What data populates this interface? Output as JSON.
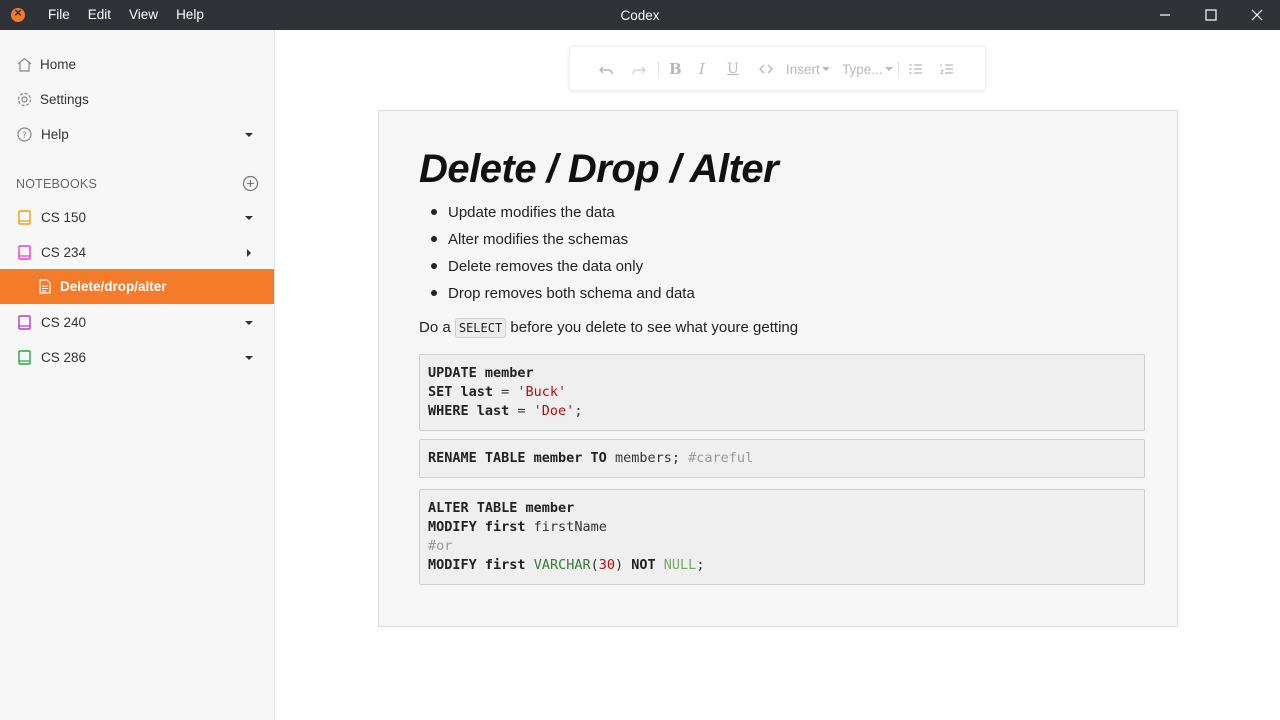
{
  "titlebar": {
    "title": "Codex",
    "menu": [
      "File",
      "Edit",
      "View",
      "Help"
    ]
  },
  "sidebar": {
    "nav": [
      {
        "label": "Home",
        "icon": "home-icon"
      },
      {
        "label": "Settings",
        "icon": "gear-icon"
      },
      {
        "label": "Help",
        "icon": "help-circle-icon"
      }
    ],
    "notebooks_header": "NOTEBOOKS",
    "notebooks": [
      {
        "label": "CS 150",
        "color": "#f39c12",
        "expanded": true
      },
      {
        "label": "CS 234",
        "color": "#e83ecf",
        "expanded": false
      },
      {
        "label": "Delete/drop/alter",
        "active": true
      },
      {
        "label": "CS 240",
        "color": "#b23ad1",
        "expanded": true
      },
      {
        "label": "CS 286",
        "color": "#27a844",
        "expanded": true
      }
    ]
  },
  "toolbar": {
    "insert_label": "Insert",
    "type_label": "Type..."
  },
  "document": {
    "title": "Delete / Drop / Alter",
    "bullets": [
      "Update modifies the data",
      "Alter modifies the schemas",
      "Delete removes the data only",
      "Drop removes both schema and data"
    ],
    "para_before": "Do a",
    "para_code": "SELECT",
    "para_after": "before you delete to see what youre getting",
    "code_blocks": [
      [
        [
          {
            "t": "UPDATE member",
            "c": "kw"
          }
        ],
        [
          {
            "t": "SET last",
            "c": "kw"
          },
          {
            "t": " = ",
            "c": ""
          },
          {
            "t": "'Buck'",
            "c": "str"
          }
        ],
        [
          {
            "t": "WHERE last",
            "c": "kw"
          },
          {
            "t": " = ",
            "c": ""
          },
          {
            "t": "'Doe'",
            "c": "str"
          },
          {
            "t": ";",
            "c": ""
          }
        ]
      ],
      [
        [
          {
            "t": "RENAME TABLE member TO",
            "c": "kw"
          },
          {
            "t": " members; ",
            "c": ""
          },
          {
            "t": "#careful",
            "c": "cm"
          }
        ]
      ],
      [
        [
          {
            "t": "ALTER TABLE member",
            "c": "kw"
          }
        ],
        [
          {
            "t": "MODIFY first",
            "c": "kw"
          },
          {
            "t": " firstName",
            "c": ""
          }
        ],
        [
          {
            "t": "#or",
            "c": "cm"
          }
        ],
        [
          {
            "t": "MODIFY first",
            "c": "kw"
          },
          {
            "t": " ",
            "c": ""
          },
          {
            "t": "VARCHAR",
            "c": "ty"
          },
          {
            "t": "(",
            "c": ""
          },
          {
            "t": "30",
            "c": "num"
          },
          {
            "t": ") ",
            "c": ""
          },
          {
            "t": "NOT",
            "c": "kw"
          },
          {
            "t": " ",
            "c": ""
          },
          {
            "t": "NULL",
            "c": "nl"
          },
          {
            "t": ";",
            "c": ""
          }
        ]
      ]
    ]
  }
}
